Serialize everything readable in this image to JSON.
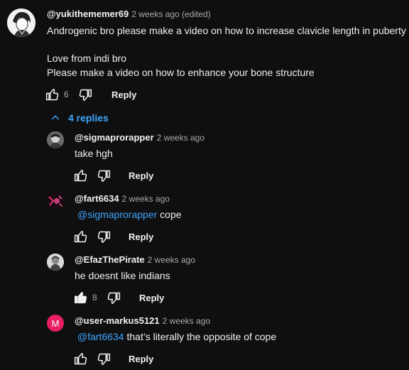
{
  "comment": {
    "handle": "@yukithememer69",
    "meta": "2 weeks ago (edited)",
    "lines": [
      "Androgenic bro please make a video on how to increase clavicle length in puberty",
      "Love from indi bro",
      "Please make a video on how to enhance your bone structure"
    ],
    "likes": "6",
    "reply_label": "Reply"
  },
  "replies_toggle": "4 replies",
  "replies": [
    {
      "handle": "@sigmaprorapper",
      "meta": "2 weeks ago",
      "mention": "",
      "text": "take hgh",
      "likes": "",
      "reply_label": "Reply"
    },
    {
      "handle": "@fart6634",
      "meta": "2 weeks ago",
      "mention": "@sigmaprorapper",
      "text": " cope",
      "likes": "",
      "reply_label": "Reply"
    },
    {
      "handle": "@EfazThePirate",
      "meta": "2 weeks ago",
      "mention": "",
      "text": "he doesnt like indians",
      "likes": "8",
      "reply_label": "Reply"
    },
    {
      "handle": "@user-markus5121",
      "meta": "2 weeks ago",
      "mention": "@fart6634",
      "text": " that’s literally the opposite of cope",
      "likes": "",
      "reply_label": "Reply",
      "avatar_letter": "M"
    }
  ],
  "colors": {
    "background": "#0f0f0f",
    "link": "#3ea6ff",
    "avatar_m": "#e91e63"
  }
}
